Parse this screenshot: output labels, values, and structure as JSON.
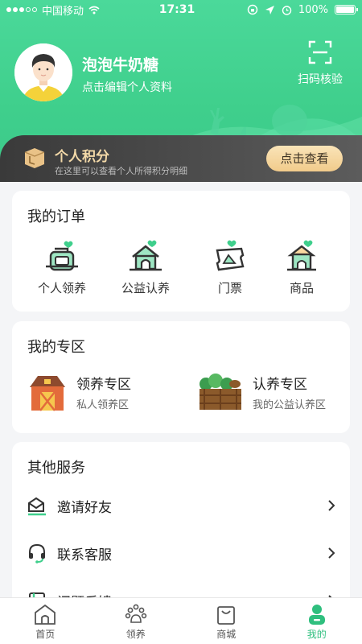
{
  "status_bar": {
    "carrier": "中国移动",
    "time": "17:31",
    "battery": "100%"
  },
  "profile": {
    "username": "泡泡牛奶糖",
    "edit_link": "点击编辑个人资料",
    "scan_label": "扫码核验"
  },
  "points": {
    "title": "个人积分",
    "subtitle": "在这里可以查看个人所得积分明细",
    "button": "点击查看"
  },
  "orders": {
    "title": "我的订单",
    "items": [
      {
        "label": "个人领养",
        "icon": "pet-carrier-icon"
      },
      {
        "label": "公益认养",
        "icon": "kennel-icon"
      },
      {
        "label": "门票",
        "icon": "ticket-icon"
      },
      {
        "label": "商品",
        "icon": "pet-house-icon"
      }
    ]
  },
  "zones": {
    "title": "我的专区",
    "items": [
      {
        "title": "领养专区",
        "subtitle": "私人领养区",
        "icon": "barn-icon"
      },
      {
        "title": "认养专区",
        "subtitle": "我的公益认养区",
        "icon": "planter-icon"
      }
    ]
  },
  "services": {
    "title": "其他服务",
    "items": [
      {
        "label": "邀请好友",
        "icon": "invite-icon"
      },
      {
        "label": "联系客服",
        "icon": "headset-icon"
      },
      {
        "label": "问题反馈",
        "icon": "feedback-icon"
      }
    ]
  },
  "tabbar": {
    "items": [
      {
        "label": "首页",
        "icon": "home-icon",
        "active": false
      },
      {
        "label": "领养",
        "icon": "paw-icon",
        "active": false
      },
      {
        "label": "商城",
        "icon": "shopping-bag-icon",
        "active": false
      },
      {
        "label": "我的",
        "icon": "profile-icon",
        "active": true
      }
    ]
  },
  "colors": {
    "brand_green": "#3fcf8c",
    "active_tab": "#2fbf7e",
    "points_gold": "#f3d9a8"
  }
}
